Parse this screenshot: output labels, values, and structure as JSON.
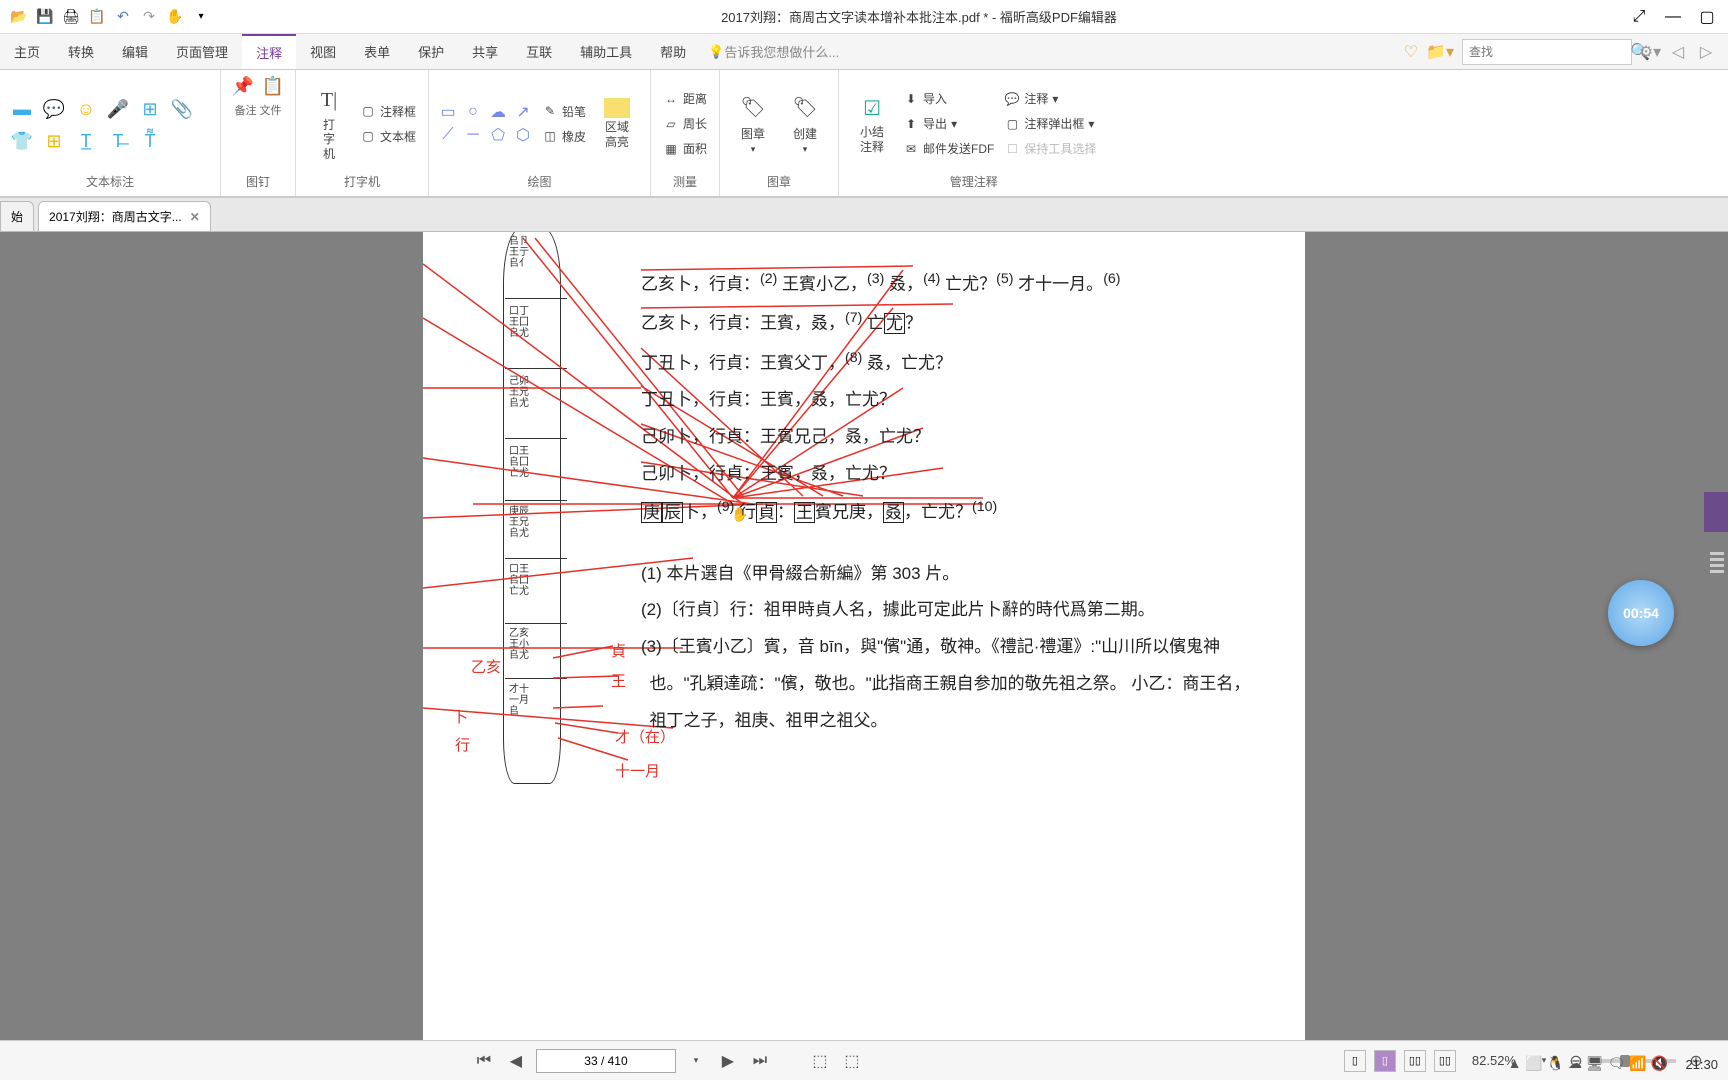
{
  "app": {
    "title": "2017刘翔：商周古文字读本增补本批注本.pdf * - 福昕高级PDF编辑器"
  },
  "menu": {
    "items": [
      "主页",
      "转换",
      "编辑",
      "页面管理",
      "注释",
      "视图",
      "表单",
      "保护",
      "共享",
      "互联",
      "辅助工具",
      "帮助"
    ],
    "active": 4,
    "hint": "告诉我您想做什么...",
    "search_placeholder": "查找"
  },
  "ribbon": {
    "groups": {
      "text_markup": "文本标注",
      "pushpin": "图钉",
      "typewriter": "打字机",
      "drawing": "绘图",
      "measure": "测量",
      "stamp": "图章",
      "manage": "管理注释"
    },
    "typewriter_btn": "打\n字\n机",
    "annotation_box": "注释框",
    "text_box": "文本框",
    "pencil": "铅笔",
    "eraser": "橡皮",
    "area_highlight": "区域\n高亮",
    "distance": "距离",
    "perimeter": "周长",
    "area": "面积",
    "stamp": "图章",
    "create": "创建",
    "summary": "小结\n注释",
    "import": "导入",
    "export": "导出",
    "send_fdf": "邮件发送FDF",
    "annotations": "注释",
    "popup": "注释弹出框",
    "keep_tool": "保持工具选择"
  },
  "tabs": {
    "home": "始",
    "doc": "2017刘翔：商周古文字..."
  },
  "doc": {
    "lines": [
      "乙亥卜，行貞：<sup>(2)</sup> 王賓小乙，<sup>(3)</sup> 叒，<sup>(4)</sup> 亡尤？<sup>(5)</sup> 才十一月。<sup>(6)</sup>",
      "乙亥卜，行貞：王賓，叒，<sup>(7)</sup> 亡<span class='boxed'>尤</span>？",
      "丁丑卜，行貞：王賓父丁，<sup>(8)</sup> 叒，亡尤？",
      "丁丑卜，行貞：王賓，叒，亡尤？",
      "己卯卜，行貞：王賓兄己，叒，亡尤？",
      "己卯卜，行貞：王賓，叒，亡尤？",
      "<span class='boxed'>庚</span><span class='boxed'>辰</span>卜，<sup>(9)</sup> 行<span class='boxed'>貞</span>：<span class='boxed'>王</span>賓兄庚，<span class='boxed'>叒</span>，亡尤？<sup>(10)</sup>"
    ],
    "notes": [
      "(1) 本片選自《甲骨綴合新編》第 303 片。",
      "(2)〔行貞〕行：祖甲時貞人名，據此可定此片卜辭的時代爲第二期。",
      "(3)〔王賓小乙〕賓，音 bīn，與\"儐\"通，敬神。《禮記·禮運》:\"山川所以儐鬼神也。\"孔穎達疏：\"儐，敬也。\"此指商王親自参加的敬先祖之祭。 小乙：商王名，祖丁之子，祖庚、祖甲之祖父。"
    ],
    "red_labels": {
      "zhen": "貞",
      "wang": "王",
      "yihai": "乙亥",
      "bu": "卜",
      "xing": "行",
      "cai": "才（在）",
      "shiyiyue": "十一月"
    }
  },
  "status": {
    "page": "33 / 410",
    "zoom": "82.52%"
  },
  "timer": "00:54",
  "clock": "21:30"
}
